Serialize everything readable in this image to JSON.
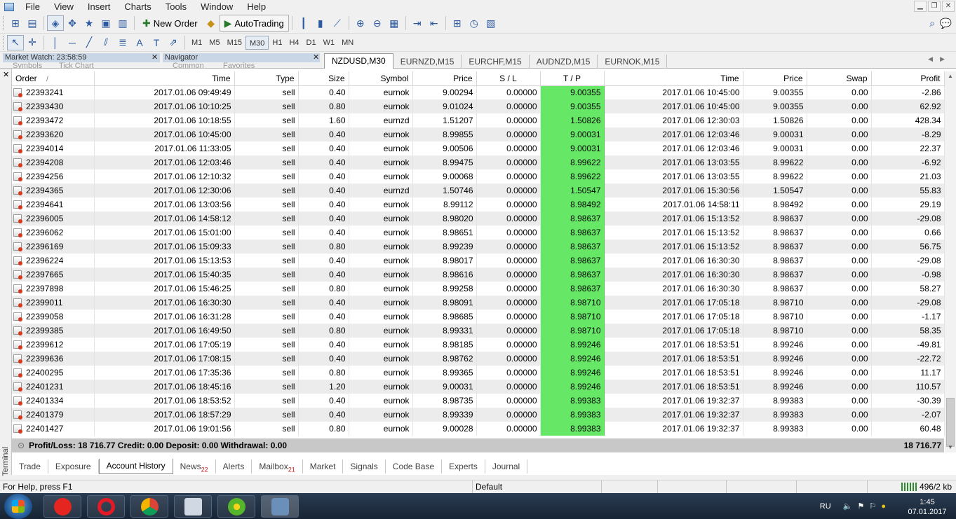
{
  "menu": {
    "items": [
      "File",
      "View",
      "Insert",
      "Charts",
      "Tools",
      "Window",
      "Help"
    ]
  },
  "toolbar": {
    "new_order_label": "New Order",
    "autotrading_label": "AutoTrading",
    "timeframes": [
      "M1",
      "M5",
      "M15",
      "M30",
      "H1",
      "H4",
      "D1",
      "W1",
      "MN"
    ],
    "active_timeframe": "M30"
  },
  "panels": {
    "market_watch_title": "Market Watch: 23:58:59",
    "navigator_title": "Navigator",
    "market_watch_tabs": [
      "Symbols",
      "Tick Chart"
    ],
    "navigator_tabs": [
      "Common",
      "Favorites"
    ]
  },
  "chart_tabs": [
    "NZDUSD,M30",
    "EURNZD,M15",
    "EURCHF,M15",
    "AUDNZD,M15",
    "EURNOK,M15"
  ],
  "active_chart_tab": "NZDUSD,M30",
  "terminal": {
    "side_label": "Terminal",
    "columns": [
      "Order",
      "Time",
      "Type",
      "Size",
      "Symbol",
      "Price",
      "S / L",
      "T / P",
      "Time",
      "Price",
      "Swap",
      "Profit"
    ],
    "sort_indicator": "/",
    "rows": [
      [
        "22393241",
        "2017.01.06 09:49:49",
        "sell",
        "0.40",
        "eurnok",
        "9.00294",
        "0.00000",
        "9.00355",
        "2017.01.06 10:45:00",
        "9.00355",
        "0.00",
        "-2.86"
      ],
      [
        "22393430",
        "2017.01.06 10:10:25",
        "sell",
        "0.80",
        "eurnok",
        "9.01024",
        "0.00000",
        "9.00355",
        "2017.01.06 10:45:00",
        "9.00355",
        "0.00",
        "62.92"
      ],
      [
        "22393472",
        "2017.01.06 10:18:55",
        "sell",
        "1.60",
        "eurnzd",
        "1.51207",
        "0.00000",
        "1.50826",
        "2017.01.06 12:30:03",
        "1.50826",
        "0.00",
        "428.34"
      ],
      [
        "22393620",
        "2017.01.06 10:45:00",
        "sell",
        "0.40",
        "eurnok",
        "8.99855",
        "0.00000",
        "9.00031",
        "2017.01.06 12:03:46",
        "9.00031",
        "0.00",
        "-8.29"
      ],
      [
        "22394014",
        "2017.01.06 11:33:05",
        "sell",
        "0.40",
        "eurnok",
        "9.00506",
        "0.00000",
        "9.00031",
        "2017.01.06 12:03:46",
        "9.00031",
        "0.00",
        "22.37"
      ],
      [
        "22394208",
        "2017.01.06 12:03:46",
        "sell",
        "0.40",
        "eurnok",
        "8.99475",
        "0.00000",
        "8.99622",
        "2017.01.06 13:03:55",
        "8.99622",
        "0.00",
        "-6.92"
      ],
      [
        "22394256",
        "2017.01.06 12:10:32",
        "sell",
        "0.40",
        "eurnok",
        "9.00068",
        "0.00000",
        "8.99622",
        "2017.01.06 13:03:55",
        "8.99622",
        "0.00",
        "21.03"
      ],
      [
        "22394365",
        "2017.01.06 12:30:06",
        "sell",
        "0.40",
        "eurnzd",
        "1.50746",
        "0.00000",
        "1.50547",
        "2017.01.06 15:30:56",
        "1.50547",
        "0.00",
        "55.83"
      ],
      [
        "22394641",
        "2017.01.06 13:03:56",
        "sell",
        "0.40",
        "eurnok",
        "8.99112",
        "0.00000",
        "8.98492",
        "2017.01.06 14:58:11",
        "8.98492",
        "0.00",
        "29.19"
      ],
      [
        "22396005",
        "2017.01.06 14:58:12",
        "sell",
        "0.40",
        "eurnok",
        "8.98020",
        "0.00000",
        "8.98637",
        "2017.01.06 15:13:52",
        "8.98637",
        "0.00",
        "-29.08"
      ],
      [
        "22396062",
        "2017.01.06 15:01:00",
        "sell",
        "0.40",
        "eurnok",
        "8.98651",
        "0.00000",
        "8.98637",
        "2017.01.06 15:13:52",
        "8.98637",
        "0.00",
        "0.66"
      ],
      [
        "22396169",
        "2017.01.06 15:09:33",
        "sell",
        "0.80",
        "eurnok",
        "8.99239",
        "0.00000",
        "8.98637",
        "2017.01.06 15:13:52",
        "8.98637",
        "0.00",
        "56.75"
      ],
      [
        "22396224",
        "2017.01.06 15:13:53",
        "sell",
        "0.40",
        "eurnok",
        "8.98017",
        "0.00000",
        "8.98637",
        "2017.01.06 16:30:30",
        "8.98637",
        "0.00",
        "-29.08"
      ],
      [
        "22397665",
        "2017.01.06 15:40:35",
        "sell",
        "0.40",
        "eurnok",
        "8.98616",
        "0.00000",
        "8.98637",
        "2017.01.06 16:30:30",
        "8.98637",
        "0.00",
        "-0.98"
      ],
      [
        "22397898",
        "2017.01.06 15:46:25",
        "sell",
        "0.80",
        "eurnok",
        "8.99258",
        "0.00000",
        "8.98637",
        "2017.01.06 16:30:30",
        "8.98637",
        "0.00",
        "58.27"
      ],
      [
        "22399011",
        "2017.01.06 16:30:30",
        "sell",
        "0.40",
        "eurnok",
        "8.98091",
        "0.00000",
        "8.98710",
        "2017.01.06 17:05:18",
        "8.98710",
        "0.00",
        "-29.08"
      ],
      [
        "22399058",
        "2017.01.06 16:31:28",
        "sell",
        "0.40",
        "eurnok",
        "8.98685",
        "0.00000",
        "8.98710",
        "2017.01.06 17:05:18",
        "8.98710",
        "0.00",
        "-1.17"
      ],
      [
        "22399385",
        "2017.01.06 16:49:50",
        "sell",
        "0.80",
        "eurnok",
        "8.99331",
        "0.00000",
        "8.98710",
        "2017.01.06 17:05:18",
        "8.98710",
        "0.00",
        "58.35"
      ],
      [
        "22399612",
        "2017.01.06 17:05:19",
        "sell",
        "0.40",
        "eurnok",
        "8.98185",
        "0.00000",
        "8.99246",
        "2017.01.06 18:53:51",
        "8.99246",
        "0.00",
        "-49.81"
      ],
      [
        "22399636",
        "2017.01.06 17:08:15",
        "sell",
        "0.40",
        "eurnok",
        "8.98762",
        "0.00000",
        "8.99246",
        "2017.01.06 18:53:51",
        "8.99246",
        "0.00",
        "-22.72"
      ],
      [
        "22400295",
        "2017.01.06 17:35:36",
        "sell",
        "0.80",
        "eurnok",
        "8.99365",
        "0.00000",
        "8.99246",
        "2017.01.06 18:53:51",
        "8.99246",
        "0.00",
        "11.17"
      ],
      [
        "22401231",
        "2017.01.06 18:45:16",
        "sell",
        "1.20",
        "eurnok",
        "9.00031",
        "0.00000",
        "8.99246",
        "2017.01.06 18:53:51",
        "8.99246",
        "0.00",
        "110.57"
      ],
      [
        "22401334",
        "2017.01.06 18:53:52",
        "sell",
        "0.40",
        "eurnok",
        "8.98735",
        "0.00000",
        "8.99383",
        "2017.01.06 19:32:37",
        "8.99383",
        "0.00",
        "-30.39"
      ],
      [
        "22401379",
        "2017.01.06 18:57:29",
        "sell",
        "0.40",
        "eurnok",
        "8.99339",
        "0.00000",
        "8.99383",
        "2017.01.06 19:32:37",
        "8.99383",
        "0.00",
        "-2.07"
      ],
      [
        "22401427",
        "2017.01.06 19:01:56",
        "sell",
        "0.80",
        "eurnok",
        "9.00028",
        "0.00000",
        "8.99383",
        "2017.01.06 19:32:37",
        "8.99383",
        "0.00",
        "60.48"
      ]
    ],
    "summary_label": "Profit/Loss: 18 716.77  Credit: 0.00  Deposit: 0.00  Withdrawal: 0.00",
    "summary_total": "18 716.77",
    "tabs": [
      {
        "label": "Trade",
        "badge": ""
      },
      {
        "label": "Exposure",
        "badge": ""
      },
      {
        "label": "Account History",
        "badge": ""
      },
      {
        "label": "News",
        "badge": "22"
      },
      {
        "label": "Alerts",
        "badge": ""
      },
      {
        "label": "Mailbox",
        "badge": "21"
      },
      {
        "label": "Market",
        "badge": ""
      },
      {
        "label": "Signals",
        "badge": ""
      },
      {
        "label": "Code Base",
        "badge": ""
      },
      {
        "label": "Experts",
        "badge": ""
      },
      {
        "label": "Journal",
        "badge": ""
      }
    ],
    "active_tab": "Account History"
  },
  "status": {
    "help": "For Help, press F1",
    "profile": "Default",
    "connection": "496/2 kb"
  },
  "taskbar": {
    "language": "RU",
    "time": "1:45",
    "date": "07.01.2017"
  },
  "colors": {
    "tp_highlight": "#66e866",
    "row_alt": "#ececec",
    "summary_bg": "#c8c8c8"
  }
}
